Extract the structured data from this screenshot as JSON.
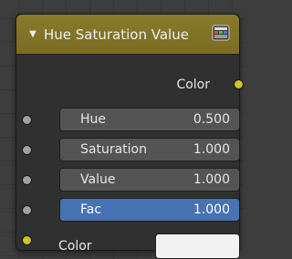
{
  "node": {
    "title": "Hue Saturation Value",
    "header_color": "#8a7a2a",
    "output": {
      "label": "Color",
      "socket_color": "#c7c729"
    },
    "inputs": [
      {
        "label": "Hue",
        "value": "0.500",
        "socket_color": "#a1a1a1",
        "active": false
      },
      {
        "label": "Saturation",
        "value": "1.000",
        "socket_color": "#a1a1a1",
        "active": false
      },
      {
        "label": "Value",
        "value": "1.000",
        "socket_color": "#a1a1a1",
        "active": false
      },
      {
        "label": "Fac",
        "value": "1.000",
        "socket_color": "#a1a1a1",
        "active": true
      }
    ],
    "color_input": {
      "label": "Color",
      "swatch_color": "#f2f2f2",
      "socket_color": "#c7c729"
    },
    "icons": {
      "collapse": "triangle-down-icon",
      "node_type": "color-node-icon"
    }
  }
}
